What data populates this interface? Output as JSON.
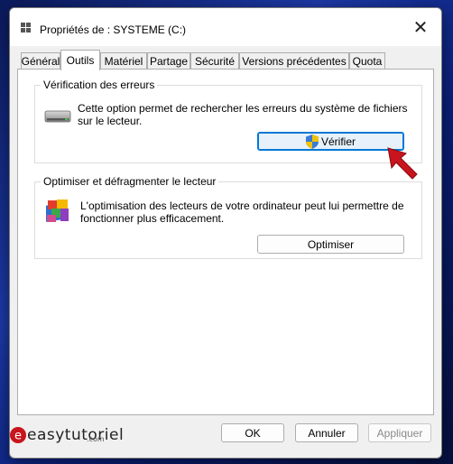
{
  "window": {
    "title": "Propriétés de : SYSTEME (C:)",
    "close_glyph": "✕"
  },
  "tabs": [
    {
      "label": "Général",
      "active": false
    },
    {
      "label": "Outils",
      "active": true
    },
    {
      "label": "Matériel",
      "active": false
    },
    {
      "label": "Partage",
      "active": false
    },
    {
      "label": "Sécurité",
      "active": false
    },
    {
      "label": "Versions précédentes",
      "active": false
    },
    {
      "label": "Quota",
      "active": false
    }
  ],
  "error_check": {
    "title": "Vérification des erreurs",
    "description": "Cette option permet de rechercher les erreurs du système de fichiers sur le lecteur.",
    "button_label": "Vérifier",
    "icon": "hard-drive-icon"
  },
  "optimize": {
    "title": "Optimiser et défragmenter le lecteur",
    "description": "L'optimisation des lecteurs de votre ordinateur peut lui permettre de fonctionner plus efficacement.",
    "button_label": "Optimiser",
    "icon": "defrag-icon"
  },
  "footer": {
    "ok_label": "OK",
    "cancel_label": "Annuler",
    "apply_label": "Appliquer"
  },
  "watermark": {
    "text": "easytutoriel",
    "suffix": ".com"
  },
  "colors": {
    "accent": "#0078d4",
    "arrow": "#c8141c"
  }
}
